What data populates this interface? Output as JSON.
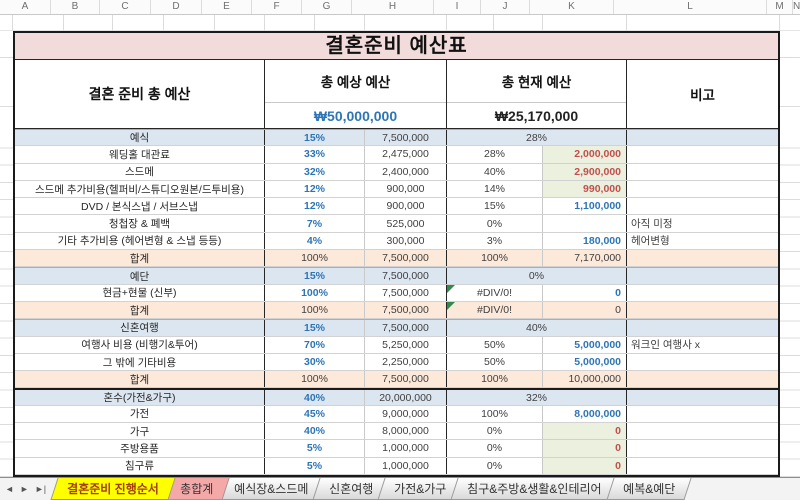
{
  "title": "결혼준비 예산표",
  "grid": {
    "column_letters": [
      "A",
      "B",
      "C",
      "D",
      "E",
      "F",
      "G",
      "H",
      "I",
      "J",
      "K",
      "L",
      "M",
      "N"
    ]
  },
  "table": {
    "label_header": "결혼 준비 총 예산",
    "expected_header": "총 예상 예산",
    "current_header": "총 현재 예산",
    "note_header": "비고",
    "expected_total": "₩50,000,000",
    "current_total": "₩25,170,000",
    "rows": [
      {
        "label": "예식",
        "row_class": "sec",
        "pct1": "15%",
        "pct1_class": "blue",
        "amt1": "7,500,000",
        "pct2": "28%",
        "pct2_class": "merged",
        "amt2": "",
        "amt2_class": "hidden",
        "note": ""
      },
      {
        "label": "웨딩홀 대관료",
        "row_class": "",
        "pct1": "33%",
        "pct1_class": "blue",
        "amt1": "2,475,000",
        "pct2": "28%",
        "pct2_class": "",
        "amt2": "2,000,000",
        "amt2_class": "neg",
        "note": ""
      },
      {
        "label": "스드메",
        "row_class": "",
        "pct1": "32%",
        "pct1_class": "blue",
        "amt1": "2,400,000",
        "pct2": "40%",
        "pct2_class": "",
        "amt2": "2,900,000",
        "amt2_class": "neg",
        "note": ""
      },
      {
        "label": "스드메 추가비용(헬퍼비/스튜디오원본/드투비용)",
        "row_class": "",
        "pct1": "12%",
        "pct1_class": "blue",
        "amt1": "900,000",
        "pct2": "14%",
        "pct2_class": "",
        "amt2": "990,000",
        "amt2_class": "neg",
        "note": ""
      },
      {
        "label": "DVD / 본식스냅 / 서브스냅",
        "row_class": "",
        "pct1": "12%",
        "pct1_class": "blue",
        "amt1": "900,000",
        "pct2": "15%",
        "pct2_class": "",
        "amt2": "1,100,000",
        "amt2_class": "pos",
        "note": ""
      },
      {
        "label": "청첩장 & 폐백",
        "row_class": "",
        "pct1": "7%",
        "pct1_class": "blue",
        "amt1": "525,000",
        "pct2": "0%",
        "pct2_class": "",
        "amt2": "",
        "amt2_class": "",
        "note": "아직 미정"
      },
      {
        "label": "기타 추가비용 (헤어변형 & 스냅 등등)",
        "row_class": "",
        "pct1": "4%",
        "pct1_class": "blue",
        "amt1": "300,000",
        "pct2": "3%",
        "pct2_class": "",
        "amt2": "180,000",
        "amt2_class": "pos",
        "note": "헤어변형"
      },
      {
        "label": "합계",
        "row_class": "tot",
        "pct1": "100%",
        "pct1_class": "",
        "amt1": "7,500,000",
        "pct2": "100%",
        "pct2_class": "",
        "amt2": "7,170,000",
        "amt2_class": "",
        "note": ""
      },
      {
        "label": "예단",
        "row_class": "sec",
        "pct1": "15%",
        "pct1_class": "blue",
        "amt1": "7,500,000",
        "pct2": "0%",
        "pct2_class": "merged",
        "amt2": "",
        "amt2_class": "hidden",
        "note": ""
      },
      {
        "label": "현금+현물 (신부)",
        "row_class": "",
        "pct1": "100%",
        "pct1_class": "blue",
        "amt1": "7,500,000",
        "pct2": "#DIV/0!",
        "pct2_class": "err",
        "amt2": "0",
        "amt2_class": "pos",
        "note": ""
      },
      {
        "label": "합계",
        "row_class": "tot",
        "pct1": "100%",
        "pct1_class": "",
        "amt1": "7,500,000",
        "pct2": "#DIV/0!",
        "pct2_class": "err",
        "amt2": "0",
        "amt2_class": "",
        "note": ""
      },
      {
        "label": "신혼여행",
        "row_class": "sec",
        "pct1": "15%",
        "pct1_class": "blue",
        "amt1": "7,500,000",
        "pct2": "40%",
        "pct2_class": "merged",
        "amt2": "",
        "amt2_class": "hidden",
        "note": ""
      },
      {
        "label": "여행사 비용 (비행기&투어)",
        "row_class": "",
        "pct1": "70%",
        "pct1_class": "blue",
        "amt1": "5,250,000",
        "pct2": "50%",
        "pct2_class": "",
        "amt2": "5,000,000",
        "amt2_class": "pos",
        "note": "워크인 여행사 x"
      },
      {
        "label": "그 밖에 기타비용",
        "row_class": "",
        "pct1": "30%",
        "pct1_class": "blue",
        "amt1": "2,250,000",
        "pct2": "50%",
        "pct2_class": "",
        "amt2": "5,000,000",
        "amt2_class": "pos",
        "note": ""
      },
      {
        "label": "합계",
        "row_class": "tot",
        "pct1": "100%",
        "pct1_class": "",
        "amt1": "7,500,000",
        "pct2": "100%",
        "pct2_class": "",
        "amt2": "10,000,000",
        "amt2_class": "",
        "note": ""
      },
      {
        "label": "혼수(가전&가구)",
        "row_class": "sec thick",
        "pct1": "40%",
        "pct1_class": "blue",
        "amt1": "20,000,000",
        "pct2": "32%",
        "pct2_class": "merged",
        "amt2": "",
        "amt2_class": "hidden",
        "note": ""
      },
      {
        "label": "가전",
        "row_class": "",
        "pct1": "45%",
        "pct1_class": "blue",
        "amt1": "9,000,000",
        "pct2": "100%",
        "pct2_class": "",
        "amt2": "8,000,000",
        "amt2_class": "pos",
        "note": ""
      },
      {
        "label": "가구",
        "row_class": "",
        "pct1": "40%",
        "pct1_class": "blue",
        "amt1": "8,000,000",
        "pct2": "0%",
        "pct2_class": "",
        "amt2": "0",
        "amt2_class": "neg",
        "note": ""
      },
      {
        "label": "주방용품",
        "row_class": "",
        "pct1": "5%",
        "pct1_class": "blue",
        "amt1": "1,000,000",
        "pct2": "0%",
        "pct2_class": "",
        "amt2": "0",
        "amt2_class": "neg",
        "note": ""
      },
      {
        "label": "침구류",
        "row_class": "",
        "pct1": "5%",
        "pct1_class": "blue",
        "amt1": "1,000,000",
        "pct2": "0%",
        "pct2_class": "",
        "amt2": "0",
        "amt2_class": "neg",
        "note": ""
      }
    ]
  },
  "sheet_tabs": {
    "nav_icons": {
      "prev": "◄",
      "next": "►",
      "last": "►|"
    },
    "tabs": [
      {
        "label": "결혼준비 진행순서",
        "kind": "active"
      },
      {
        "label": "총합계",
        "kind": "pink"
      },
      {
        "label": "예식장&스드메",
        "kind": ""
      },
      {
        "label": "신혼여행",
        "kind": ""
      },
      {
        "label": "가전&가구",
        "kind": ""
      },
      {
        "label": "침구&주방&생활&인테리어",
        "kind": ""
      },
      {
        "label": "예복&예단",
        "kind": ""
      }
    ]
  },
  "colors": {
    "title_bg": "#F2DCDB",
    "section_row_bg": "#DCE6F1",
    "total_row_bg": "#FDE9D9",
    "highlight_cell_bg": "#EBF1DE",
    "accent_blue": "#2E75B6",
    "negative_red": "#C0504D",
    "active_tab_bg": "#FFFF00",
    "active_tab_text": "#A33E03",
    "pink_tab_bg": "#F4A8A8",
    "error_marker_green": "#2F8A4C"
  }
}
